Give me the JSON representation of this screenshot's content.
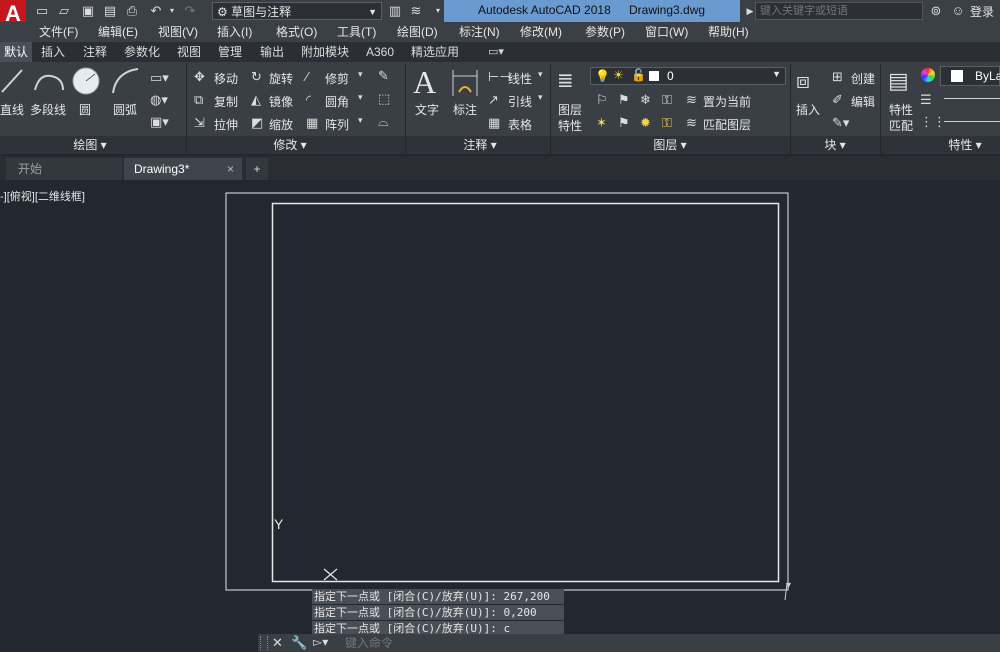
{
  "titlebar": {
    "app_logo": "A",
    "workspace": "草图与注释",
    "title_app": "Autodesk AutoCAD 2018",
    "title_file": "Drawing3.dwg",
    "search_placeholder": "键入关键字或短语",
    "login": "登录"
  },
  "menus": [
    "文件(F)",
    "编辑(E)",
    "视图(V)",
    "插入(I)",
    "格式(O)",
    "工具(T)",
    "绘图(D)",
    "标注(N)",
    "修改(M)",
    "参数(P)",
    "窗口(W)",
    "帮助(H)"
  ],
  "ribbon_tabs": [
    "默认",
    "插入",
    "注释",
    "参数化",
    "视图",
    "管理",
    "输出",
    "附加模块",
    "A360",
    "精选应用"
  ],
  "draw_panel": {
    "line": "直线",
    "polyline": "多段线",
    "circle": "圆",
    "arc": "圆弧",
    "title": "绘图"
  },
  "modify_panel": {
    "move": "移动",
    "rotate": "旋转",
    "trim": "修剪",
    "copy": "复制",
    "mirror": "镜像",
    "fillet": "圆角",
    "stretch": "拉伸",
    "scale": "缩放",
    "array": "阵列",
    "title": "修改"
  },
  "annotation_panel": {
    "text": "文字",
    "dimension": "标注",
    "linear": "线性",
    "leader": "引线",
    "table": "表格",
    "title": "注释"
  },
  "layers_panel": {
    "layer_props_1": "图层",
    "layer_props_2": "特性",
    "layer_name": "0",
    "make_current": "置为当前",
    "match_layer": "匹配图层",
    "title": "图层"
  },
  "block_panel": {
    "insert": "插入",
    "create": "创建",
    "edit": "编辑",
    "title": "块"
  },
  "properties_panel": {
    "match_1": "特性",
    "match_2": "匹配",
    "bylayer": "ByLa",
    "title": "特性"
  },
  "doc_tabs": {
    "start": "开始",
    "drawing": "Drawing3*",
    "close": "×",
    "add": "+"
  },
  "viewport_label": "-][俯视][二维线框]",
  "ucs": {
    "y": "Y",
    "x": "X"
  },
  "command_history": [
    "指定下一点或 [闭合(C)/放弃(U)]: 267,200",
    "指定下一点或 [闭合(C)/放弃(U)]: 0,200",
    "指定下一点或 [闭合(C)/放弃(U)]: c"
  ],
  "command_placeholder": "键入命令"
}
